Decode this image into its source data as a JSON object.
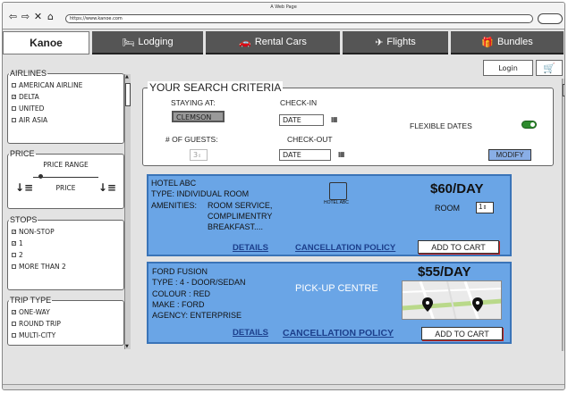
{
  "window": {
    "title": "A Web Page",
    "url": "https://www.kanoe.com"
  },
  "tabs": [
    {
      "label": "Kanoe",
      "icon": ""
    },
    {
      "label": "Lodging",
      "icon": "bed-icon"
    },
    {
      "label": "Rental Cars",
      "icon": "car-icon"
    },
    {
      "label": "Flights",
      "icon": "plane-icon"
    },
    {
      "label": "Bundles",
      "icon": "gift-icon"
    }
  ],
  "account": {
    "login": "Login"
  },
  "filters": {
    "airlines": {
      "title": "AIRLINES",
      "options": [
        {
          "label": "AMERICAN AIRLINE",
          "checked": false
        },
        {
          "label": "DELTA",
          "checked": true
        },
        {
          "label": "UNITED",
          "checked": false
        },
        {
          "label": "AIR ASIA",
          "checked": false
        }
      ]
    },
    "price": {
      "title": "PRICE",
      "range_label": "PRICE RANGE",
      "sort_label": "PRICE"
    },
    "stops": {
      "title": "STOPS",
      "options": [
        {
          "label": "NON-STOP",
          "checked": true
        },
        {
          "label": "1",
          "checked": true
        },
        {
          "label": "2",
          "checked": false
        },
        {
          "label": "MORE THAN 2",
          "checked": false
        }
      ]
    },
    "trip_type": {
      "title": "TRIP TYPE",
      "options": [
        {
          "label": "ONE-WAY",
          "checked": true
        },
        {
          "label": "ROUND TRIP",
          "checked": false
        },
        {
          "label": "MULTI-CITY",
          "checked": false
        }
      ]
    }
  },
  "search": {
    "title": "YOUR SEARCH CRITERIA",
    "staying_label": "STAYING AT:",
    "staying_value": "CLEMSON",
    "guests_label": "# OF GUESTS:",
    "guests_value": "3",
    "checkin_label": "CHECK-IN",
    "checkin_value": "DATE",
    "checkout_label": "CHECK-OUT",
    "checkout_value": "DATE",
    "flexible_label": "FLEXIBLE DATES",
    "flexible_on": true,
    "modify_label": "MODIFY"
  },
  "results": [
    {
      "name": "HOTEL ABC",
      "type": "TYPE: INDIVIDUAL ROOM",
      "amenities_label": "AMENITIES:",
      "amenities": [
        "ROOM SERVICE,",
        "COMPLIMENTRY",
        "BREAKFAST...."
      ],
      "image_caption": "HOTEL ABC",
      "price": "$60/DAY",
      "room_label": "ROOM",
      "room_value": "1",
      "details": "DETAILS",
      "policy": "CANCELLATION POLICY",
      "add_to_cart": "ADD TO CART"
    },
    {
      "name": "FORD FUSION",
      "type": "TYPE : 4 - DOOR/SEDAN",
      "colour": "COLOUR : RED",
      "make": "MAKE : FORD",
      "agency": "AGENCY: ENTERPRISE",
      "pickup": "PICK-UP CENTRE",
      "price": "$55/DAY",
      "details": "DETAILS",
      "policy": "CANCELLATION POLICY",
      "add_to_cart": "ADD TO CART"
    }
  ],
  "colors": {
    "accent_blue": "#6aa5e6",
    "tab_dark": "#555555",
    "toggle_green": "#2e8b2e"
  }
}
